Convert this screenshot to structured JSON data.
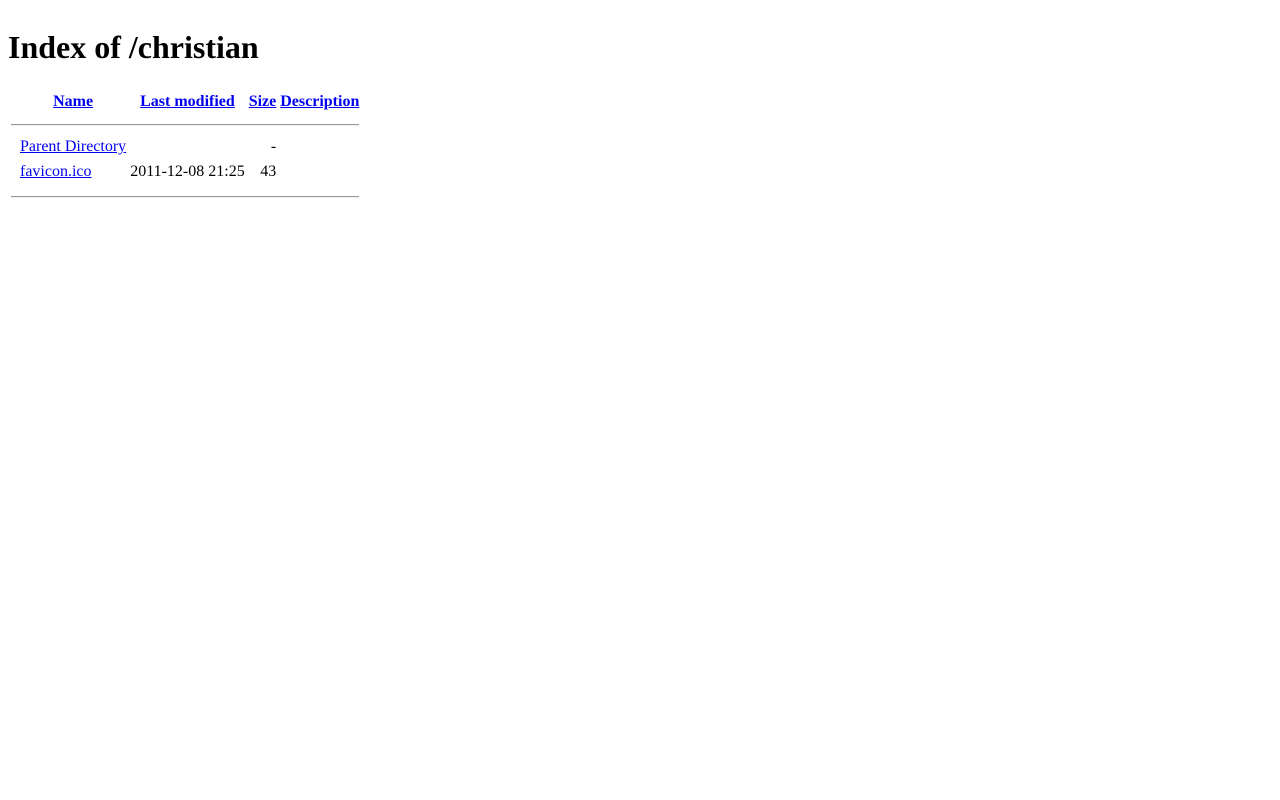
{
  "page": {
    "title": "Index of /christian"
  },
  "table": {
    "headers": {
      "name": "Name",
      "last_modified": "Last modified",
      "size": "Size",
      "description": "Description"
    },
    "rows": [
      {
        "name": "Parent Directory",
        "last_modified": "",
        "size": "-",
        "description": ""
      },
      {
        "name": "favicon.ico",
        "last_modified": "2011-12-08 21:25",
        "size": "43",
        "description": ""
      }
    ]
  }
}
